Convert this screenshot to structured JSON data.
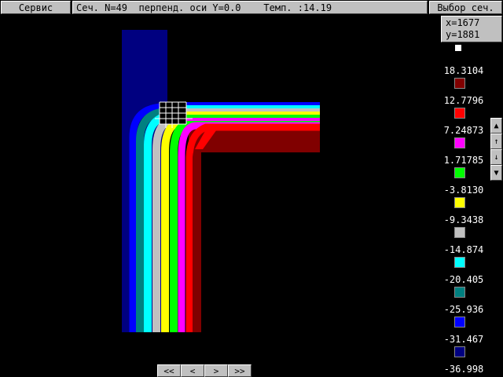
{
  "toolbar": {
    "service_label": "Сервис",
    "status_text": "Сеч. N=49  перпенд. оси Y=0.0    Темп. :14.19",
    "select_section_label": "Выбор сеч."
  },
  "coords": {
    "x": "x=1677",
    "y": "y=1881"
  },
  "legend": {
    "values": [
      "18.3104",
      "12.7796",
      "7.24873",
      "1.71785",
      "-3.8130",
      "-9.3438",
      "-14.874",
      "-20.405",
      "-25.936",
      "-31.467",
      "-36.998"
    ],
    "colors": [
      "#800000",
      "#ff0000",
      "#ff00ff",
      "#00ff00",
      "#ffff00",
      "#c0c0c0",
      "#00ffff",
      "#008080",
      "#0000ff",
      "#000080"
    ]
  },
  "scroll": {
    "up_page": "▲",
    "up": "↑",
    "down": "↓",
    "down_page": "▼"
  },
  "nav": {
    "first": "<<",
    "prev": "<",
    "next": ">",
    "last": ">>"
  }
}
